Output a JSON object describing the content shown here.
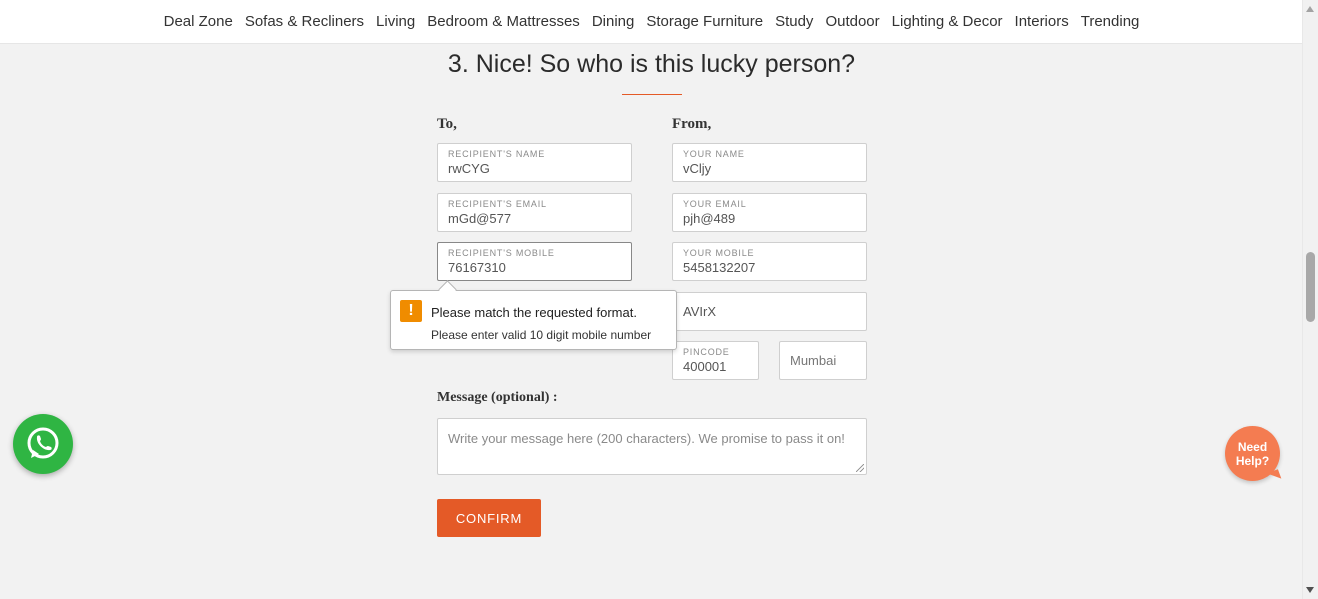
{
  "nav": {
    "items": [
      "Deal Zone",
      "Sofas & Recliners",
      "Living",
      "Bedroom & Mattresses",
      "Dining",
      "Storage Furniture",
      "Study",
      "Outdoor",
      "Lighting & Decor",
      "Interiors",
      "Trending"
    ]
  },
  "heading": "3. Nice! So who is this lucky person?",
  "to": {
    "label": "To,",
    "name_label": "RECIPIENT'S NAME",
    "name_value": "rwCYG",
    "email_label": "RECIPIENT'S EMAIL",
    "email_value": "mGd@577",
    "mobile_label": "RECIPIENT'S MOBILE",
    "mobile_value": "76167310"
  },
  "from": {
    "label": "From,",
    "name_label": "YOUR NAME",
    "name_value": "vCljy",
    "email_label": "YOUR EMAIL",
    "email_value": "pjh@489",
    "mobile_label": "YOUR MOBILE",
    "mobile_value": "5458132207",
    "address_value": "AVIrX",
    "pincode_label": "PINCODE",
    "pincode_value": "400001",
    "city_value": "Mumbai"
  },
  "tooltip": {
    "title": "Please match the requested format.",
    "message": "Please enter valid 10 digit mobile number",
    "icon": "warning-icon",
    "icon_glyph": "!"
  },
  "message": {
    "label": "Message (optional) :",
    "placeholder": "Write your message here (200 characters). We promise to pass it on!"
  },
  "confirm_label": "CONFIRM",
  "help": {
    "need_help": "Need Help?"
  },
  "colors": {
    "accent": "#e45a27",
    "whatsapp": "#2fb543",
    "help_bubble": "#f47c51",
    "warning": "#f08c00"
  }
}
